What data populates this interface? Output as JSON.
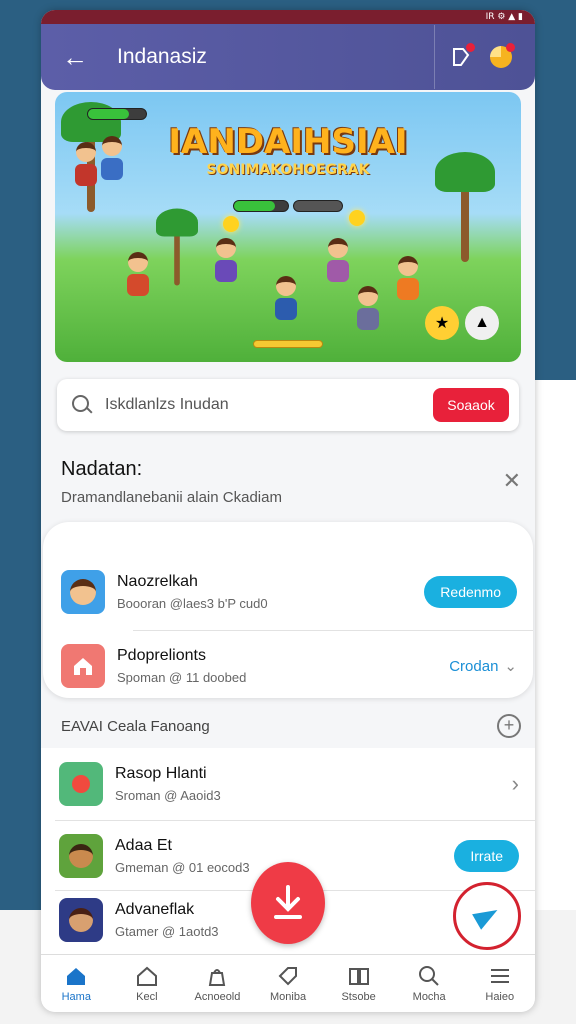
{
  "statusbar": {
    "icons": "IR ⚙ ▲ ▮"
  },
  "appbar": {
    "title": "Indanasiz",
    "back_icon": "arrow-left-icon",
    "tag_icon": "tag-icon",
    "profile_icon": "pie-icon"
  },
  "banner": {
    "title": "IANDAIHSIAI",
    "subtitle": "SONIMAKOHOEGRAK"
  },
  "search": {
    "value": "Iskdlanlzs Inudan",
    "button": "Soaaok"
  },
  "section": {
    "title": "Nadatan:",
    "subtitle": "Dramandlanebanii alain Ckadiam"
  },
  "card_items": [
    {
      "name": "Naozrelkah",
      "meta": "Boooran @laes3 b'P cud0",
      "action": "Redenmo"
    },
    {
      "name": "Pdoprelionts",
      "meta": "Spoman @ 11 doobed",
      "action": "Crodan"
    }
  ],
  "section2": {
    "label": "EAVAI Ceala Fanoang"
  },
  "list_items": [
    {
      "name": "Rasop Hlanti",
      "meta": "Sroman @ Aaoid3",
      "action": ""
    },
    {
      "name": "Adaa Et",
      "meta": "Gmeman @ 01 eocod3",
      "action": "Irrate"
    },
    {
      "name": "Advaneflak",
      "meta": "Gtamer @ 1aotd3",
      "action": ""
    }
  ],
  "navbar": [
    {
      "label": "Hama",
      "icon": "home-icon"
    },
    {
      "label": "Kecl",
      "icon": "house-outline-icon"
    },
    {
      "label": "Acnoeold",
      "icon": "bag-icon"
    },
    {
      "label": "Moniba",
      "icon": "tag-icon"
    },
    {
      "label": "Stsobe",
      "icon": "book-icon"
    },
    {
      "label": "Mocha",
      "icon": "search-icon"
    },
    {
      "label": "Haieo",
      "icon": "menu-icon"
    }
  ],
  "colors": {
    "accent": "#1ab0e0",
    "danger": "#e8213a",
    "appbar": "#5c5ea8"
  }
}
